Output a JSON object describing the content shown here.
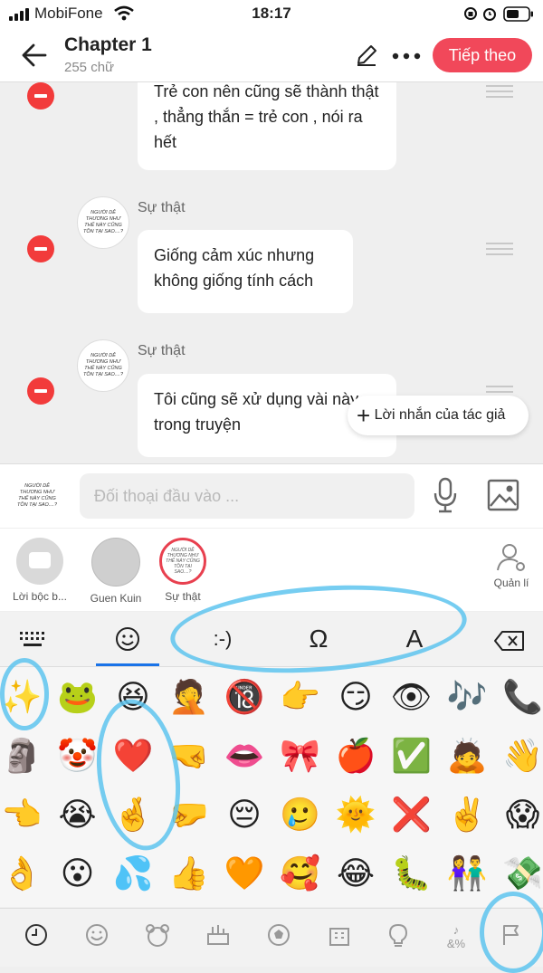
{
  "status_bar": {
    "carrier": "MobiFone",
    "time": "18:17"
  },
  "header": {
    "title": "Chapter 1",
    "word_count": "255 chữ",
    "next_label": "Tiếp theo"
  },
  "messages": [
    {
      "text": "Trẻ con nên cũng sẽ thành thật , thẳng thắn = trẻ con , nói ra hết"
    },
    {
      "speaker": "Sự thật",
      "text": "Giống cảm xúc nhưng không giống tính cách"
    },
    {
      "speaker": "Sự thật",
      "text": "Tôi cũng sẽ xử dụng vài này trong truyện"
    }
  ],
  "avatar_text": "NGƯỜI DỄ THƯƠNG NHƯ THẾ NÀY CŨNG TỒN TẠI SAO....?",
  "author_note_label": "Lời nhắn của tác giả",
  "input": {
    "placeholder": "Đối thoại đầu vào ..."
  },
  "characters": [
    {
      "name": "Lời bộc b..."
    },
    {
      "name": "Guen Kuin"
    },
    {
      "name": "Sự thật"
    }
  ],
  "manage_label": "Quản lí",
  "keyboard": {
    "tabs": [
      ":-)",
      "Ω",
      "A"
    ],
    "emojis": [
      [
        "✨",
        "🐸",
        "😆",
        "🤦",
        "🔞",
        "👉",
        "😏",
        "👁",
        "🎶",
        "📞"
      ],
      [
        "🗿",
        "🤡",
        "❤️",
        "🤜",
        "👄",
        "🎀",
        "🍎",
        "✅",
        "🙇",
        "👋"
      ],
      [
        "👈",
        "😭",
        "🤞",
        "🤛",
        "😔",
        "🥲",
        "🌞",
        "❌",
        "✌️",
        "😱"
      ],
      [
        "👌",
        "😮",
        "💦",
        "👍",
        "🧡",
        "🥰",
        "😂",
        "🐛",
        "👫",
        "💸"
      ]
    ],
    "categories": [
      "clock-icon",
      "smiley-icon",
      "bear-icon",
      "food-icon",
      "ball-icon",
      "building-icon",
      "bulb-icon",
      "symbols-icon",
      "flag-icon"
    ]
  }
}
